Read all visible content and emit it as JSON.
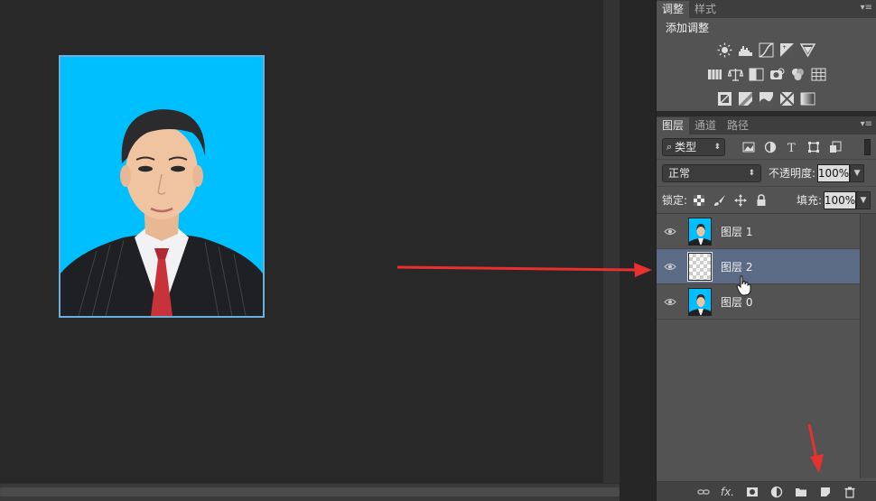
{
  "adjustments_panel": {
    "tabs": [
      "调整",
      "样式"
    ],
    "menu_icon": "panel-menu-icon",
    "title": "添加调整",
    "icon_rows": [
      [
        "brightness-contrast-icon",
        "levels-icon",
        "curves-icon",
        "exposure-icon",
        "vibrance-icon"
      ],
      [
        "hue-saturation-icon",
        "color-balance-icon",
        "black-white-icon",
        "photo-filter-icon",
        "channel-mixer-icon",
        "color-lookup-icon"
      ],
      [
        "invert-icon",
        "posterize-icon",
        "threshold-icon",
        "selective-color-icon",
        "gradient-map-icon"
      ]
    ]
  },
  "layers_panel": {
    "tabs": [
      "图层",
      "通道",
      "路径"
    ],
    "filter_kind": "类型",
    "filter_icons": [
      "pixel-filter-icon",
      "adjustment-filter-icon",
      "type-filter-icon",
      "shape-filter-icon",
      "smart-object-filter-icon"
    ],
    "blend_mode": "正常",
    "opacity_label": "不透明度:",
    "opacity_value": "100%",
    "lock_label": "锁定:",
    "fill_label": "填充:",
    "fill_value": "100%",
    "layers": [
      {
        "name": "图层 1",
        "selected": false,
        "thumb": "photo"
      },
      {
        "name": "图层 2",
        "selected": true,
        "thumb": "transparent"
      },
      {
        "name": "图层 0",
        "selected": false,
        "thumb": "photo"
      }
    ],
    "bottom_icons": [
      "link-layers-icon",
      "fx-icon",
      "add-mask-icon",
      "adjustment-layer-icon",
      "new-group-icon",
      "new-layer-icon",
      "delete-layer-icon"
    ],
    "fx_label": "fx."
  },
  "colors": {
    "photo_bg": "#00bfff",
    "selection": "#5c6b85",
    "annotation_arrow": "#e8302f"
  }
}
